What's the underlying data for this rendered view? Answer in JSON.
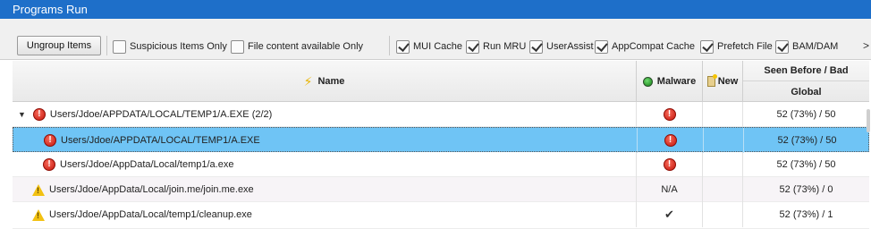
{
  "window": {
    "title": "Programs Run"
  },
  "toolbar": {
    "ungroup_label": "Ungroup Items",
    "filters": [
      {
        "label": "Suspicious Items Only",
        "checked": false
      },
      {
        "label": "File content available Only",
        "checked": false
      },
      {
        "label": "MUI Cache",
        "checked": true
      },
      {
        "label": "Run MRU",
        "checked": true
      },
      {
        "label": "UserAssist",
        "checked": true
      },
      {
        "label": "AppCompat Cache",
        "checked": true
      },
      {
        "label": "Prefetch File",
        "checked": true
      },
      {
        "label": "BAM/DAM",
        "checked": true
      }
    ],
    "more_label": ">"
  },
  "table": {
    "columns": {
      "name": "Name",
      "malware": "Malware",
      "new": "New",
      "seen_before": "Seen Before / Bad",
      "global": "Global"
    },
    "rows": [
      {
        "name": "Users/Jdoe/APPDATA/LOCAL/TEMP1/A.EXE (2/2)",
        "icon": "error-icon",
        "malware": "error-icon",
        "new": "",
        "global": "52 (73%) / 50",
        "expanded": true
      },
      {
        "name": "Users/Jdoe/APPDATA/LOCAL/TEMP1/A.EXE",
        "icon": "error-icon",
        "malware": "error-icon",
        "new": "",
        "global": "52 (73%) / 50",
        "selected": true
      },
      {
        "name": "Users/Jdoe/AppData/Local/temp1/a.exe",
        "icon": "error-icon",
        "malware": "error-icon",
        "new": "",
        "global": "52 (73%) / 50"
      },
      {
        "name": "Users/Jdoe/AppData/Local/join.me/join.me.exe",
        "icon": "warning-icon",
        "malware": "N/A",
        "new": "",
        "global": "52 (73%) / 0"
      },
      {
        "name": "Users/Jdoe/AppData/Local/temp1/cleanup.exe",
        "icon": "warning-icon",
        "malware": "check-icon",
        "new": "",
        "global": "52 (73%) / 1"
      }
    ]
  },
  "colors": {
    "titlebar": "#1e6fc9",
    "selection": "#6fc4f5",
    "error": "#d9261c",
    "warning": "#f2c112"
  }
}
